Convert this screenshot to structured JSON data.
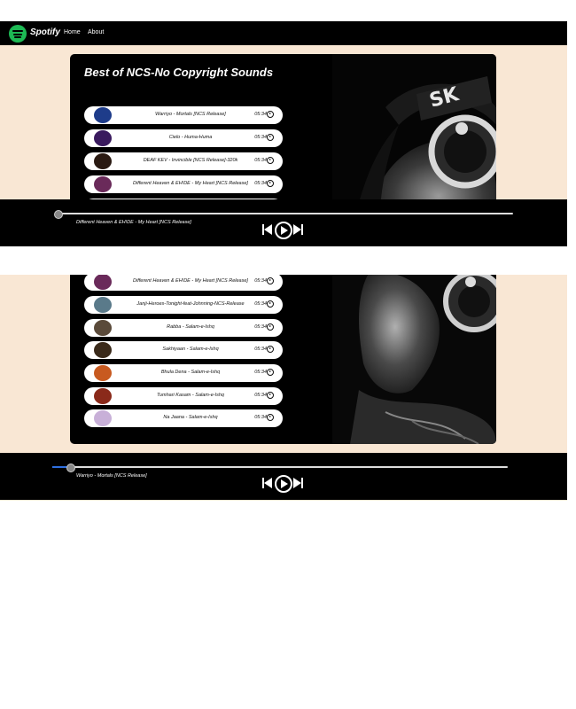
{
  "nav": {
    "brand": "Spotify",
    "links": [
      "Home",
      "About"
    ]
  },
  "playlist_title": "Best of NCS-No Copyright Sounds",
  "songs": [
    {
      "title": "Warriyo - Mortals [NCS Release]",
      "duration": "05:34",
      "thumb_color": "#1e3c8a"
    },
    {
      "title": "Cielo - Huma-Huma",
      "duration": "05:34",
      "thumb_color": "#3a1a5e"
    },
    {
      "title": "DEAF KEV - Invincible [NCS Release]-320k",
      "duration": "05:34",
      "thumb_color": "#2a1a12"
    },
    {
      "title": "Different Heaven & EH!DE - My Heart [NCS Release]",
      "duration": "05:34",
      "thumb_color": "#6a2a5a"
    },
    {
      "title": "Janji-Heroes-Tonight-feat-Johnning-NCS-Release",
      "duration": "05:34",
      "thumb_color": "#5a7a8a"
    },
    {
      "title": "Rabba - Salam-e-Ishq",
      "duration": "05:34",
      "thumb_color": "#5a4a3a"
    },
    {
      "title": "Sakhiyaan - Salam-e-Ishq",
      "duration": "05:34",
      "thumb_color": "#3a2a1a"
    },
    {
      "title": "Bhula Dena - Salam-e-Ishq",
      "duration": "05:34",
      "thumb_color": "#c85a20"
    },
    {
      "title": "Tumhari Kasam - Salam-e-Ishq",
      "duration": "05:34",
      "thumb_color": "#8a2a1a"
    },
    {
      "title": "Na Jaana - Salam-e-Ishq",
      "duration": "05:34",
      "thumb_color": "#c8b0d8"
    }
  ],
  "player_1": {
    "now_playing": "Different Heaven & EH!DE - My Heart [NCS Release]",
    "progress_percent": 0
  },
  "player_2": {
    "now_playing": "Warriyo - Mortals [NCS Release]",
    "progress_percent": 3
  },
  "colors": {
    "page_bg": "#f9e7d4",
    "spotify_green": "#1db954",
    "progress_fill": "#2f6fe0"
  }
}
